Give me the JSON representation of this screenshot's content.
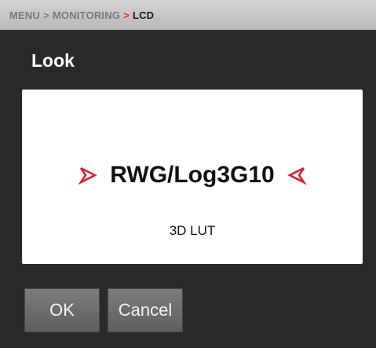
{
  "breadcrumb": {
    "items": [
      "MENU",
      "MONITORING",
      "LCD"
    ],
    "separator": ">"
  },
  "dialog": {
    "title": "Look",
    "value": "RWG/Log3G10",
    "subtitle": "3D LUT"
  },
  "buttons": {
    "ok_label": "OK",
    "cancel_label": "Cancel"
  },
  "colors": {
    "accent": "#d6262a",
    "background": "#2a2a2a",
    "panel": "#ffffff"
  },
  "icons": {
    "left_arrow": "chevron-right-icon",
    "right_arrow": "chevron-left-icon"
  }
}
